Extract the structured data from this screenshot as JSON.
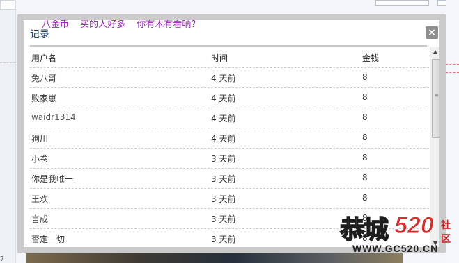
{
  "marquee": [
    "八金币",
    "买的人好多",
    "你有木有看呐？"
  ],
  "dialog": {
    "title": "记录",
    "close_label": "×"
  },
  "table": {
    "headers": [
      "用户名",
      "时间",
      "金钱"
    ],
    "rows": [
      [
        "兔八哥",
        "4 天前",
        "8"
      ],
      [
        "败家崽",
        "4 天前",
        "8"
      ],
      [
        "waidr1314",
        "4 天前",
        "8"
      ],
      [
        "狗川",
        "4 天前",
        "8"
      ],
      [
        "小卷",
        "3 天前",
        "8"
      ],
      [
        "你是我唯一",
        "3 天前",
        "8"
      ],
      [
        "王欢",
        "3 天前",
        "8"
      ],
      [
        "言成",
        "3 天前",
        "8"
      ],
      [
        "否定一切",
        "3 天前",
        "8"
      ]
    ]
  },
  "scrollbar": {
    "up_icon": "▲",
    "down_icon": "▼",
    "grip": "≡"
  },
  "background": {
    "left_mark": "7"
  },
  "watermark": {
    "brand": "恭城",
    "number": "520",
    "she": "社",
    "qu": "区",
    "url": "WWW.GC520.CN"
  }
}
